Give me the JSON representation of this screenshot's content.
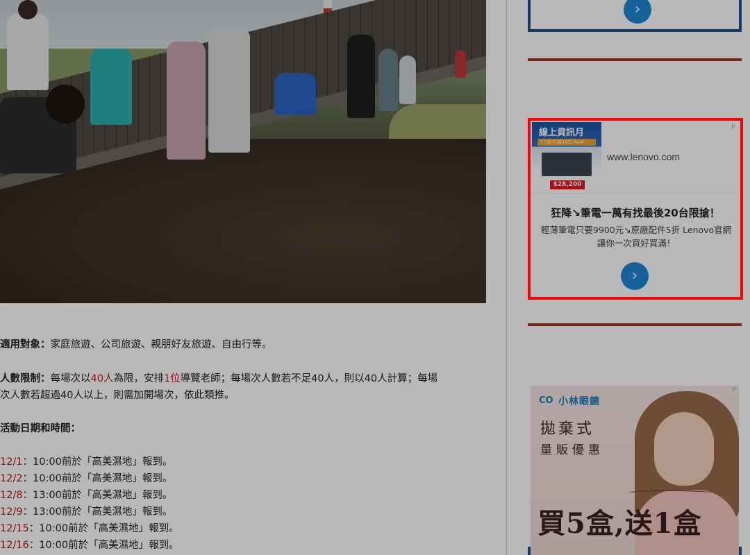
{
  "article": {
    "paragraphs": {
      "audience": {
        "label": "適用對象：",
        "text": "家庭旅遊、公司旅遊、親朋好友旅遊、自由行等。"
      },
      "headcount": {
        "label": "人數限制：",
        "pre1": "每場次以",
        "red1": "40人",
        "mid1": "為限，安排",
        "red2": "1位",
        "post1": "導覽老師；每場次人數若不足40人，則以40人計算；每場",
        "line2": "次人數若超過40人以上，則需加開場次，依此類推。"
      },
      "schedule_heading": "活動日期和時間："
    },
    "schedule": [
      {
        "date": "12/1",
        "text": "：10:00前於「高美濕地」報到。"
      },
      {
        "date": "12/2",
        "text": "：10:00前於「高美濕地」報到。"
      },
      {
        "date": "12/8",
        "text": "：13:00前於「高美濕地」報到。"
      },
      {
        "date": "12/9",
        "text": "：13:00前於「高美濕地」報到。"
      },
      {
        "date": "12/15",
        "text": "：10:00前於「高美濕地」報到。"
      },
      {
        "date": "12/16",
        "text": "：10:00前於「高美濕地」報到。"
      }
    ]
  },
  "sidebar": {
    "top_ad": {
      "button_glyph": "›"
    },
    "lenovo_ad": {
      "thumb_title": "線上資訊月",
      "thumb_promo": "7.5折升級16G RAM",
      "thumb_price": "$28,200",
      "url": "www.lenovo.com",
      "headline": "狂降↘筆電一萬有找最後20台限搶！",
      "description": "輕薄筆電只要9900元↘原廠配件5折 Lenovo官網讓你一次買好買滿！",
      "button_glyph": "›",
      "adchoice": "P"
    },
    "kobayashi_ad": {
      "brand": "小林眼鏡",
      "logo_mark": "CO",
      "tagline1": "拋棄式",
      "tagline2": "量販優惠",
      "promo": "買5盒,送1盒",
      "adchoice": "P"
    }
  },
  "colors": {
    "accent_blue": "#1e88d7",
    "frame_blue": "#1f4e8c",
    "separator_red": "#a23a26",
    "highlight_red": "#ff0000",
    "text_red": "#c0161a"
  }
}
